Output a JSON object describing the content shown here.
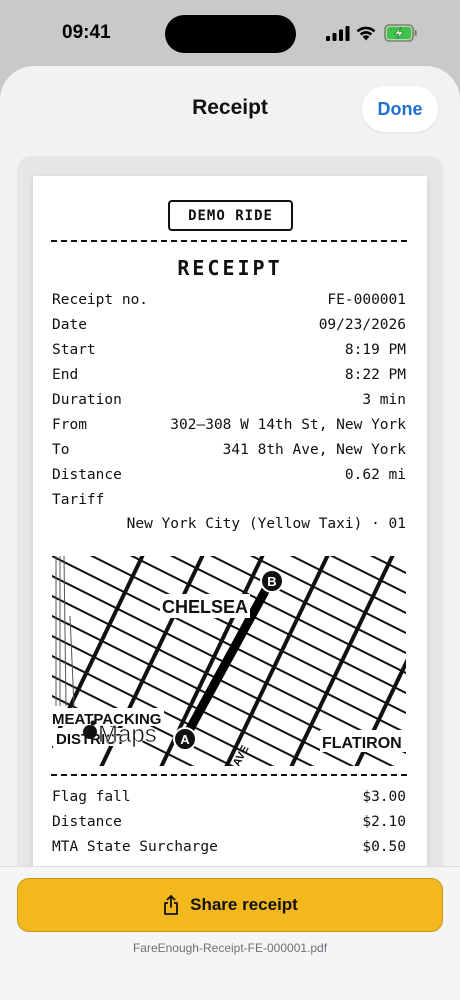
{
  "status_bar": {
    "time": "09:41"
  },
  "sheet": {
    "title": "Receipt",
    "done_label": "Done"
  },
  "receipt": {
    "badge": "DEMO RIDE",
    "heading": "RECEIPT",
    "details": [
      {
        "label": "Receipt no.",
        "value": "FE-000001"
      },
      {
        "label": "Date",
        "value": "09/23/2026"
      },
      {
        "label": "Start",
        "value": "8:19 PM"
      },
      {
        "label": "End",
        "value": "8:22 PM"
      },
      {
        "label": "Duration",
        "value": "3 min"
      },
      {
        "label": "From",
        "value": "302–308 W 14th St, New York"
      },
      {
        "label": "To",
        "value": "341 8th Ave, New York"
      },
      {
        "label": "Distance",
        "value": "0.62 mi"
      }
    ],
    "tariff": {
      "label": "Tariff",
      "value": "New York City (Yellow Taxi) · 01"
    },
    "map": {
      "labels": {
        "chelsea": "CHELSEA",
        "meatpacking_1": "MEATPACKING",
        "meatpacking_2": "DISTRICT",
        "flatiron": "FLATIRON",
        "avenue": "AVE"
      },
      "maps_brand": "Maps",
      "marker_start": "A",
      "marker_end": "B"
    },
    "charges": [
      {
        "label": "Flag fall",
        "value": "$3.00"
      },
      {
        "label": "Distance",
        "value": "$2.10"
      },
      {
        "label": "MTA State Surcharge",
        "value": "$0.50"
      }
    ]
  },
  "share": {
    "label": "Share receipt",
    "file_name": "FareEnough-Receipt-FE-000001.pdf"
  },
  "colors": {
    "accent": "#f4b81f",
    "link": "#1f6fd1"
  }
}
